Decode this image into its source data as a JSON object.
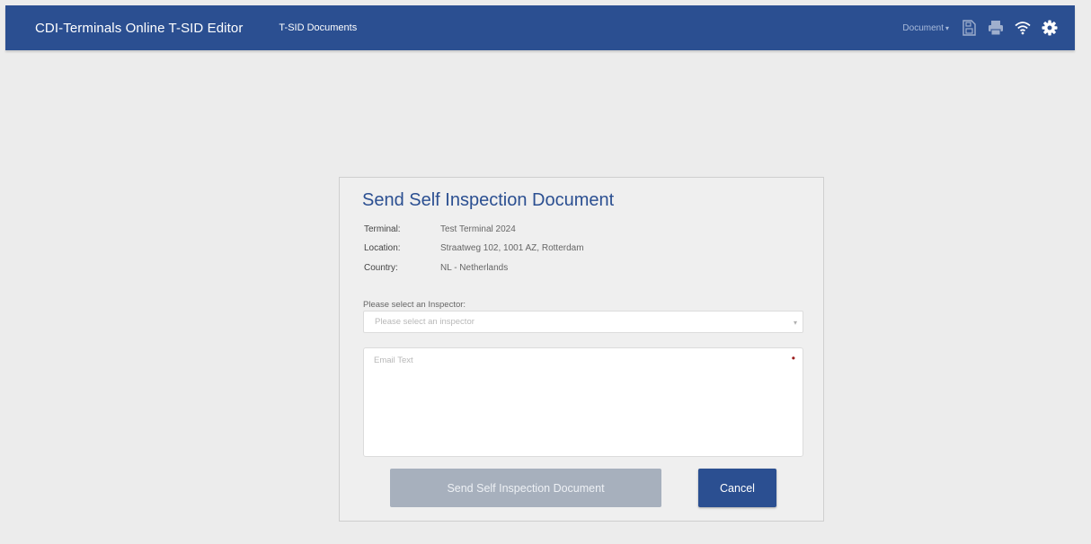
{
  "header": {
    "app_title": "CDI-Terminals Online T-SID Editor",
    "nav_link": "T-SID Documents",
    "document_menu": "Document",
    "icons": [
      "save-icon",
      "print-icon",
      "wifi-icon",
      "gear-icon"
    ],
    "bar_color": "#2b4f91"
  },
  "dialog": {
    "title": "Send Self Inspection Document",
    "info": [
      {
        "label": "Terminal:",
        "value": "Test Terminal 2024"
      },
      {
        "label": "Location:",
        "value": "Straatweg 102, 1001 AZ, Rotterdam"
      },
      {
        "label": "Country:",
        "value": "NL - Netherlands"
      }
    ],
    "inspector_label": "Please select an Inspector:",
    "inspector_placeholder": "Please select an inspector",
    "email_placeholder": "Email Text",
    "required_marker": "•",
    "send_button": "Send Self Inspection Document",
    "cancel_button": "Cancel",
    "accent_color": "#2b4f91",
    "disabled_color": "#a7b0bd"
  }
}
